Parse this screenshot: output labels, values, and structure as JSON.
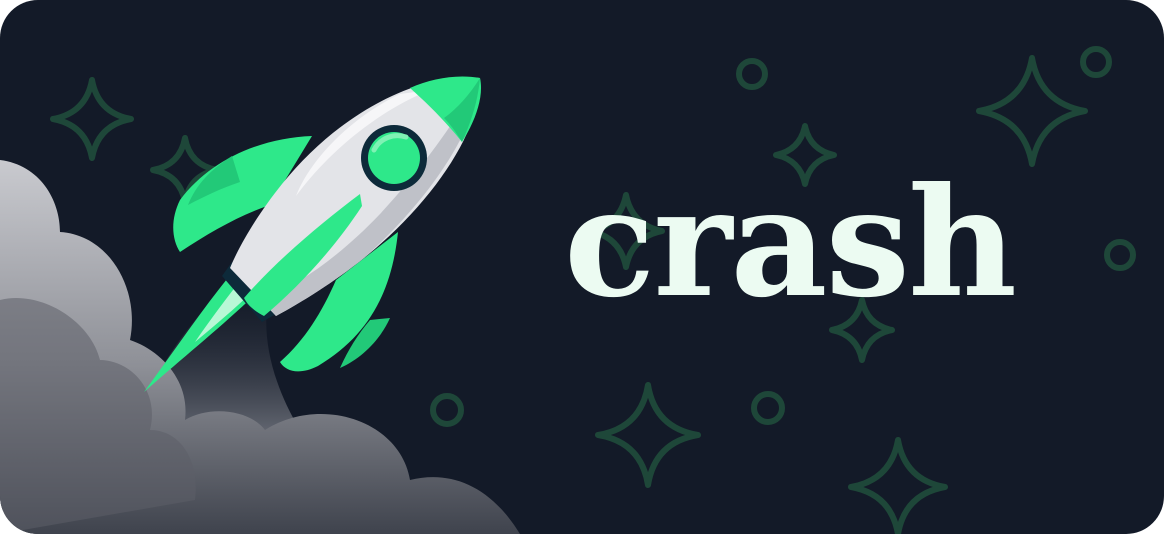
{
  "banner": {
    "title": "crash"
  },
  "colors": {
    "background": "#131a28",
    "accent_green": "#2ee88a",
    "title_text": "#ecfbf2",
    "rocket_body": "#e3e4e8",
    "smoke": "#9a9ca3"
  },
  "icons": {
    "mascot": "rocket-icon",
    "decoration": [
      "sparkle-star-icon",
      "ring-icon",
      "smoke-cloud"
    ]
  }
}
